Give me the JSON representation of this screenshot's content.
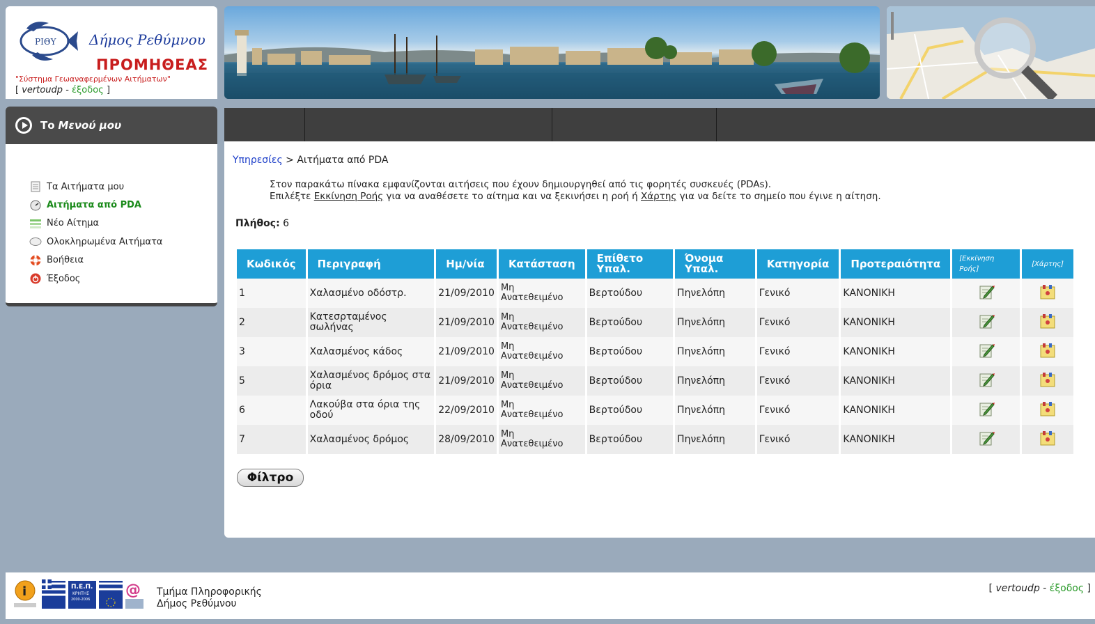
{
  "header": {
    "logo_title": "Δήμος Ρεθύμνου",
    "logo_system": "ΠΡΟΜΗΘΕΑΣ",
    "logo_subtitle": "\"Σύστημα Γεωαναφερμένων Αιτήματων\"",
    "user": "vertoudp",
    "exit_link": "έξοδος",
    "logo_emblem": "ΡΙΘΥ"
  },
  "sidebar": {
    "title_prefix": "Το",
    "title_em": "Μενού μου",
    "items": [
      {
        "label": "Τα Αιτήματα μου",
        "icon": "document-icon"
      },
      {
        "label": "Αιτήματα από PDA",
        "icon": "gauge-icon"
      },
      {
        "label": "Νέο Αίτημα",
        "icon": "list-icon"
      },
      {
        "label": "Ολοκληρωμένα Αιτήματα",
        "icon": "bubble-icon"
      },
      {
        "label": "Βοήθεια",
        "icon": "lifebuoy-icon"
      },
      {
        "label": "Έξοδος",
        "icon": "power-icon"
      }
    ]
  },
  "main": {
    "breadcrumb_link": "Υπηρεσίες",
    "breadcrumb_sep": " > ",
    "breadcrumb_current": "Αιτήματα από PDA",
    "intro_line1": "Στον παρακάτω πίνακα εμφανίζονται αιτήσεις που έχουν δημιουργηθεί από τις φορητές συσκευές (PDAs).",
    "intro_line2_a": "Επιλέξτε ",
    "intro_line2_link1": "Εκκίνηση Ροής",
    "intro_line2_b": " για να αναθέσετε το αίτημα και να ξεκινήσει η ροή ή ",
    "intro_line2_link2": "Χάρτης",
    "intro_line2_c": " για να δείτε το σημείο που έγινε η αίτηση.",
    "count_label": "Πλήθος:",
    "count_value": "6",
    "filter_button": "Φίλτρο"
  },
  "table": {
    "headers": {
      "code": "Κωδικός",
      "description": "Περιγραφή",
      "date": "Ημ/νία",
      "status": "Κατάσταση",
      "surname_1": "Επίθετο",
      "surname_2": "Υπαλ.",
      "name_1": "Όνομα",
      "name_2": "Υπαλ.",
      "category": "Κατηγορία",
      "priority": "Προτεραιότητα",
      "start_flow_1": "[Εκκίνηση",
      "start_flow_2": "Ροής]",
      "map": "[Χάρτης]"
    },
    "rows": [
      {
        "code": "1",
        "description": "Χαλασμένο οδόστρ.",
        "date": "21/09/2010",
        "status_1": "Μη",
        "status_2": "Ανατεθειμένο",
        "surname": "Βερτούδου",
        "name": "Πηνελόπη",
        "category": "Γενικό",
        "priority": "ΚΑΝΟΝΙΚΗ"
      },
      {
        "code": "2",
        "description": "Κατεσρταμένος σωλήνας",
        "date": "21/09/2010",
        "status_1": "Μη",
        "status_2": "Ανατεθειμένο",
        "surname": "Βερτούδου",
        "name": "Πηνελόπη",
        "category": "Γενικό",
        "priority": "ΚΑΝΟΝΙΚΗ"
      },
      {
        "code": "3",
        "description": "Χαλασμένος κάδος",
        "date": "21/09/2010",
        "status_1": "Μη",
        "status_2": "Ανατεθειμένο",
        "surname": "Βερτούδου",
        "name": "Πηνελόπη",
        "category": "Γενικό",
        "priority": "ΚΑΝΟΝΙΚΗ"
      },
      {
        "code": "5",
        "description": "Χαλασμένος δρόμος στα όρια",
        "date": "21/09/2010",
        "status_1": "Μη",
        "status_2": "Ανατεθειμένο",
        "surname": "Βερτούδου",
        "name": "Πηνελόπη",
        "category": "Γενικό",
        "priority": "ΚΑΝΟΝΙΚΗ"
      },
      {
        "code": "6",
        "description": "Λακούβα στα όρια της οδού",
        "date": "22/09/2010",
        "status_1": "Μη",
        "status_2": "Ανατεθειμένο",
        "surname": "Βερτούδου",
        "name": "Πηνελόπη",
        "category": "Γενικό",
        "priority": "ΚΑΝΟΝΙΚΗ"
      },
      {
        "code": "7",
        "description": "Χαλασμένος δρόμος",
        "date": "28/09/2010",
        "status_1": "Μη",
        "status_2": "Ανατεθειμένο",
        "surname": "Βερτούδου",
        "name": "Πηνελόπη",
        "category": "Γενικό",
        "priority": "ΚΑΝΟΝΙΚΗ"
      }
    ]
  },
  "footer": {
    "dept_line1": "Τμήμα Πληροφορικής",
    "dept_line2": "Δήμος Ρεθύμνου",
    "user": "vertoudp",
    "exit_link": "έξοδος",
    "badge_pep": "Π.Ε.Π.",
    "badge_region": "ΚΡΗΤΗΣ",
    "badge_years": "2000-2006"
  },
  "colors": {
    "table_header": "#1e9ed6",
    "active_menu": "#1a8a1a",
    "logo_red": "#c81d1d",
    "logo_blue": "#1b3a9b",
    "page_bg": "#9aaabb"
  }
}
